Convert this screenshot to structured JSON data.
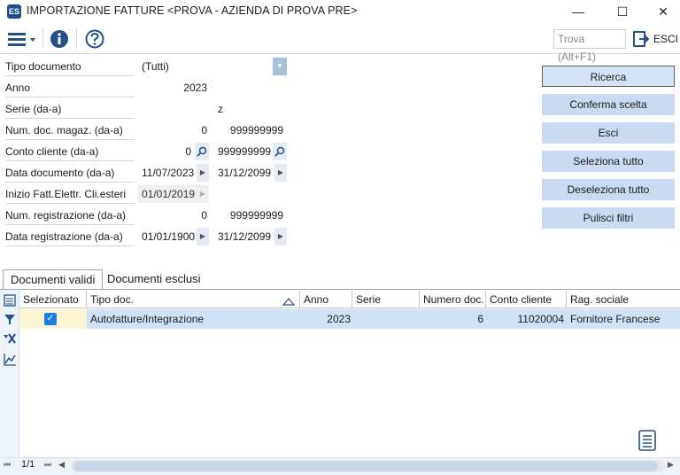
{
  "window": {
    "title": "IMPORTAZIONE FATTURE <PROVA - AZIENDA DI PROVA PRE>",
    "app_icon_label": "ES",
    "minimize": "—",
    "maximize": "☐",
    "close": "✕"
  },
  "toolbar": {
    "search_placeholder": "Trova (Alt+F1)",
    "exit_label": "ESCI"
  },
  "form": {
    "tipo_documento": {
      "label": "Tipo documento",
      "value": "(Tutti)"
    },
    "anno": {
      "label": "Anno",
      "value": "2023"
    },
    "serie": {
      "label": "Serie (da-a)",
      "from": "",
      "to": "z"
    },
    "num_doc_magaz": {
      "label": "Num. doc. magaz. (da-a)",
      "from": "0",
      "to": "999999999"
    },
    "conto_cliente": {
      "label": "Conto cliente (da-a)",
      "from": "0",
      "to": "999999999"
    },
    "data_documento": {
      "label": "Data documento (da-a)",
      "from": "11/07/2023",
      "to": "31/12/2099"
    },
    "inizio_fatt": {
      "label": "Inizio Fatt.Elettr. Cli.esteri",
      "value": "01/01/2019"
    },
    "num_registrazione": {
      "label": "Num. registrazione (da-a)",
      "from": "0",
      "to": "999999999"
    },
    "data_registrazione": {
      "label": "Data registrazione (da-a)",
      "from": "01/01/1900",
      "to": "31/12/2099"
    }
  },
  "actions": {
    "ricerca": "Ricerca",
    "conferma": "Conferma scelta",
    "esci": "Esci",
    "seleziona_tutto": "Seleziona tutto",
    "deseleziona_tutto": "Deseleziona tutto",
    "pulisci_filtri": "Pulisci filtri"
  },
  "tabs": [
    {
      "label": "Documenti validi",
      "active": true
    },
    {
      "label": "Documenti esclusi",
      "active": false
    }
  ],
  "grid": {
    "columns": [
      "Selezionato",
      "Tipo doc.",
      "Anno",
      "Serie",
      "Numero doc.",
      "Conto cliente",
      "Rag. sociale"
    ],
    "rows": [
      {
        "selezionato": true,
        "tipo_doc": "Autofatture/Integrazione",
        "anno": "2023",
        "serie": "",
        "numero_doc": "6",
        "conto_cliente": "11020004",
        "rag_sociale": "Fornitore Francese"
      }
    ]
  },
  "pager": {
    "page": "1/1"
  },
  "colors": {
    "accent": "#1f7ee0",
    "button_bg": "#c9daf1",
    "row_selected": "#cfe2f6"
  }
}
